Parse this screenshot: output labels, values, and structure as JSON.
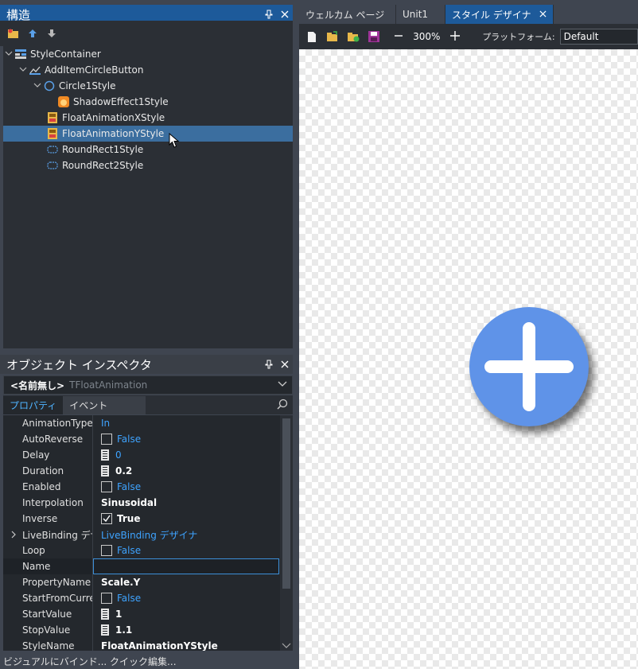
{
  "structure_panel": {
    "title": "構造",
    "pin_icon": "pin-icon",
    "close_icon": "close-icon",
    "toolbar_icons": [
      "folder-star-icon",
      "arrow-up-icon",
      "arrow-down-icon"
    ],
    "tree": [
      {
        "label": "StyleContainer",
        "icon": "layout-icon",
        "expanded": true
      },
      {
        "label": "AddItemCircleButton",
        "icon": "button-icon",
        "expanded": true
      },
      {
        "label": "Circle1Style",
        "icon": "circle-icon",
        "expanded": true
      },
      {
        "label": "ShadowEffect1Style",
        "icon": "shadow-effect-icon"
      },
      {
        "label": "FloatAnimationXStyle",
        "icon": "animation-icon"
      },
      {
        "label": "FloatAnimationYStyle",
        "icon": "animation-icon",
        "selected": true
      },
      {
        "label": "RoundRect1Style",
        "icon": "roundrect-icon"
      },
      {
        "label": "RoundRect2Style",
        "icon": "roundrect-icon"
      }
    ]
  },
  "inspector": {
    "title": "オブジェクト インスペクタ",
    "object_name": "<名前無し>",
    "object_type": "TFloatAnimation",
    "tabs": [
      "プロパティ",
      "イベント"
    ],
    "properties": [
      {
        "name": "AnimationType",
        "value": "In",
        "style": "blue"
      },
      {
        "name": "AutoReverse",
        "value": "False",
        "style": "blue",
        "checkbox": false
      },
      {
        "name": "Delay",
        "value": "0",
        "style": "blue",
        "dots": true
      },
      {
        "name": "Duration",
        "value": "0.2",
        "style": "bold",
        "dots": true
      },
      {
        "name": "Enabled",
        "value": "False",
        "style": "blue",
        "checkbox": false
      },
      {
        "name": "Interpolation",
        "value": "Sinusoidal",
        "style": "bold"
      },
      {
        "name": "Inverse",
        "value": "True",
        "style": "bold",
        "checkbox": true
      },
      {
        "name": "LiveBinding デザ",
        "value": "LiveBinding デザイナ",
        "style": "blue",
        "expandable": true
      },
      {
        "name": "Loop",
        "value": "False",
        "style": "blue",
        "checkbox": false
      },
      {
        "name": "Name",
        "value": "",
        "style": "edit"
      },
      {
        "name": "PropertyName",
        "value": "Scale.Y",
        "style": "bold"
      },
      {
        "name": "StartFromCurren",
        "value": "False",
        "style": "blue",
        "checkbox": false
      },
      {
        "name": "StartValue",
        "value": "1",
        "style": "bold",
        "dots": true
      },
      {
        "name": "StopValue",
        "value": "1.1",
        "style": "bold",
        "dots": true
      },
      {
        "name": "StyleName",
        "value": "FloatAnimationYStyle",
        "style": "bold"
      }
    ],
    "status": "ビジュアルにバインド... クイック編集..."
  },
  "designer": {
    "tabs": [
      {
        "label": "ウェルカム ページ",
        "active": false
      },
      {
        "label": "Unit1",
        "active": false
      },
      {
        "label": "スタイル デザイナ",
        "active": true
      }
    ],
    "toolbar_icons": [
      "new-file-icon",
      "open-folder-icon",
      "add-folder-icon",
      "save-icon"
    ],
    "zoom": "300%",
    "platform_label": "プラットフォーム:",
    "platform_value": "Default",
    "canvas_button": "plus-icon",
    "colors": {
      "accent": "#1d5a9a",
      "button": "#5f93e8",
      "selection": "#3b6e9f"
    }
  }
}
